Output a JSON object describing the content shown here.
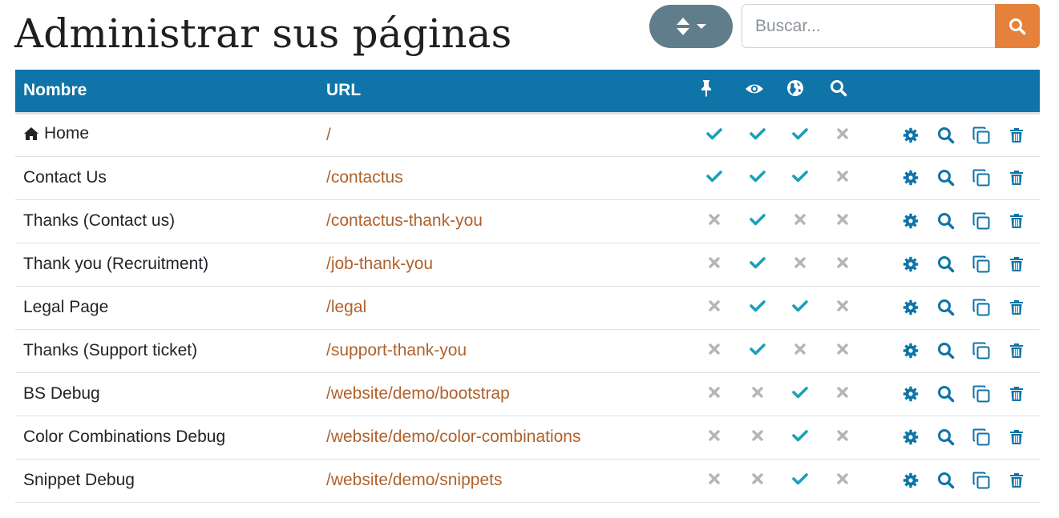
{
  "header": {
    "title": "Administrar sus páginas",
    "search_placeholder": "Buscar..."
  },
  "colors": {
    "header_bg": "#0f74a8",
    "accent": "#e5813b",
    "sort_button": "#607d8b",
    "link": "#b0612b",
    "check": "#1aa0b8",
    "cross": "#b5b5b5",
    "action_icon": "#0f74a8"
  },
  "table": {
    "columns": {
      "name": "Nombre",
      "url": "URL",
      "menu_icon": "pin-icon",
      "visible_icon": "eye-icon",
      "published_icon": "globe-icon",
      "indexed_icon": "search-icon"
    },
    "rows": [
      {
        "name": "Home",
        "home": true,
        "url": "/",
        "menu": true,
        "visible": true,
        "published": true,
        "indexed": false
      },
      {
        "name": "Contact Us",
        "url": "/contactus",
        "menu": true,
        "visible": true,
        "published": true,
        "indexed": false
      },
      {
        "name": "Thanks (Contact us)",
        "url": "/contactus-thank-you",
        "menu": false,
        "visible": true,
        "published": false,
        "indexed": false
      },
      {
        "name": "Thank you (Recruitment)",
        "url": "/job-thank-you",
        "menu": false,
        "visible": true,
        "published": false,
        "indexed": false
      },
      {
        "name": "Legal Page",
        "url": "/legal",
        "menu": false,
        "visible": true,
        "published": true,
        "indexed": false
      },
      {
        "name": "Thanks (Support ticket)",
        "url": "/support-thank-you",
        "menu": false,
        "visible": true,
        "published": false,
        "indexed": false
      },
      {
        "name": "BS Debug",
        "url": "/website/demo/bootstrap",
        "menu": false,
        "visible": false,
        "published": true,
        "indexed": false
      },
      {
        "name": "Color Combinations Debug",
        "url": "/website/demo/color-combinations",
        "menu": false,
        "visible": false,
        "published": true,
        "indexed": false
      },
      {
        "name": "Snippet Debug",
        "url": "/website/demo/snippets",
        "menu": false,
        "visible": false,
        "published": true,
        "indexed": false
      }
    ]
  }
}
